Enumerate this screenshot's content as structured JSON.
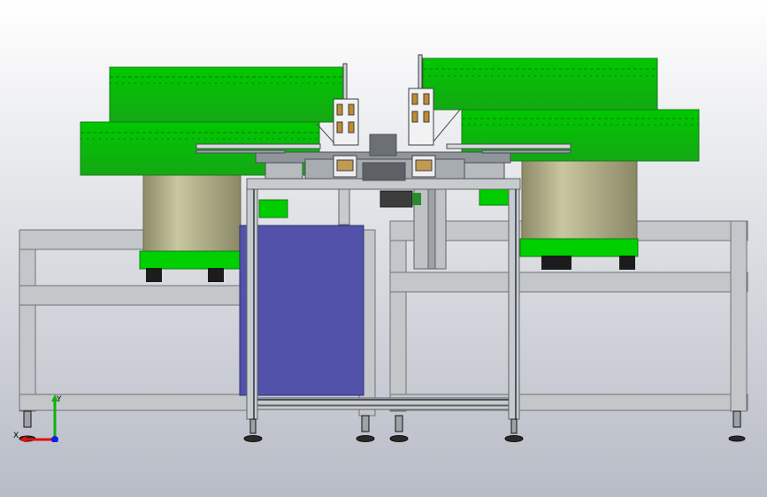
{
  "viewport": {
    "background_top": "#ffffff",
    "background_bottom": "#b8bcc6"
  },
  "colors": {
    "bowl_green": "#00cc00",
    "bowl_green_dark": "#1a8f1a",
    "bowl_base": "#b6b48a",
    "frame_steel": "#bfc2c5",
    "frame_edge": "#6e7377",
    "panel_blue": "#5050a8",
    "foot_black": "#1f1f1f"
  },
  "triad": {
    "x_label": "X",
    "y_label": "Y",
    "x_color": "#e01010",
    "y_color": "#10b010",
    "z_color": "#1020e0"
  }
}
